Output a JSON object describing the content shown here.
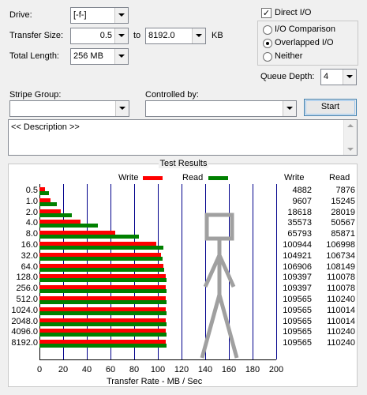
{
  "form": {
    "drive_label": "Drive:",
    "drive_value": "[-f-]",
    "transfer_size_label": "Transfer Size:",
    "transfer_from": "0.5",
    "to_label": "to",
    "transfer_to": "8192.0",
    "kb_label": "KB",
    "total_length_label": "Total Length:",
    "total_length_value": "256 MB",
    "direct_io_label": "Direct I/O",
    "direct_io_checked": true,
    "mode_options": [
      {
        "label": "I/O Comparison",
        "selected": false
      },
      {
        "label": "Overlapped I/O",
        "selected": true
      },
      {
        "label": "Neither",
        "selected": false
      }
    ],
    "queue_depth_label": "Queue Depth:",
    "queue_depth_value": "4",
    "stripe_group_label": "Stripe Group:",
    "stripe_group_value": "",
    "controlled_by_label": "Controlled by:",
    "controlled_by_value": "",
    "start_label": "Start",
    "description": "<< Description >>"
  },
  "results": {
    "title": "Test Results",
    "write_legend": "Write",
    "read_legend": "Read",
    "write_col": "Write",
    "read_col": "Read",
    "write_color": "#ff0000",
    "read_color": "#008000",
    "xlabel": "Transfer Rate - MB / Sec"
  },
  "chart_data": {
    "type": "bar",
    "orientation": "horizontal",
    "xlabel": "Transfer Rate - MB / Sec",
    "xlim": [
      0,
      200
    ],
    "xticks": [
      "0",
      "20",
      "40",
      "60",
      "80",
      "100",
      "120",
      "140",
      "160",
      "180",
      "200"
    ],
    "categories": [
      "0.5",
      "1.0",
      "2.0",
      "4.0",
      "8.0",
      "16.0",
      "32.0",
      "64.0",
      "128.0",
      "256.0",
      "512.0",
      "1024.0",
      "2048.0",
      "4096.0",
      "8192.0"
    ],
    "series": [
      {
        "name": "Write",
        "values": [
          4882,
          9607,
          18618,
          35573,
          65793,
          100944,
          104921,
          106906,
          109397,
          109397,
          109565,
          109565,
          109565,
          109565,
          109565
        ]
      },
      {
        "name": "Read",
        "values": [
          7876,
          15245,
          28019,
          50567,
          85871,
          106998,
          106734,
          108149,
          110078,
          110078,
          110240,
          110014,
          110014,
          110240,
          110240
        ]
      }
    ]
  }
}
